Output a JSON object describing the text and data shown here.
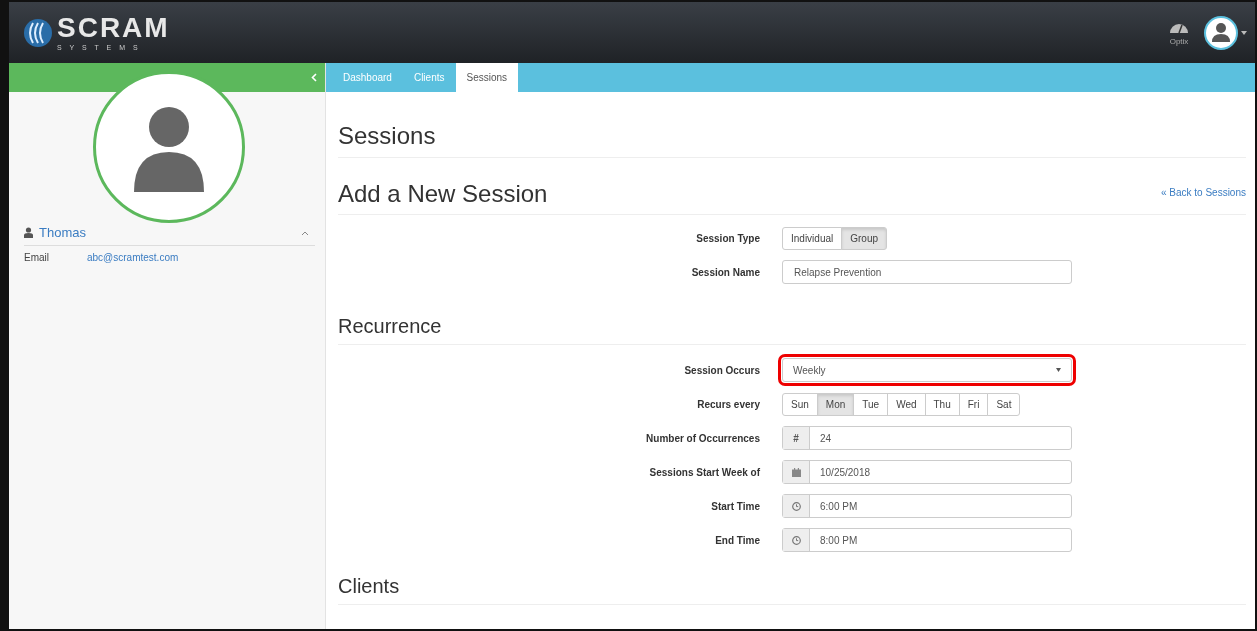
{
  "header": {
    "logo_text": "SCRAM",
    "logo_subtext": "S Y S T E M S",
    "optix_label": "Optix"
  },
  "sidebar": {
    "client_name": "Thomas",
    "expanded": true,
    "details": [
      {
        "label": "Email",
        "value": "abc@scramtest.com"
      }
    ]
  },
  "tabs": [
    {
      "label": "Dashboard",
      "selected": false
    },
    {
      "label": "Clients",
      "selected": false
    },
    {
      "label": "Sessions",
      "selected": true
    }
  ],
  "page_title": "Sessions",
  "form_title": "Add a New Session",
  "back_link": "« Back to Sessions",
  "session_type": {
    "label": "Session Type",
    "options": [
      {
        "label": "Individual",
        "selected": false
      },
      {
        "label": "Group",
        "selected": true
      }
    ]
  },
  "session_name": {
    "label": "Session Name",
    "value": "Relapse Prevention"
  },
  "recurrence_title": "Recurrence",
  "session_occurs": {
    "label": "Session Occurs",
    "value": "Weekly",
    "highlighted": true
  },
  "recurs_every": {
    "label": "Recurs every",
    "days": [
      {
        "label": "Sun",
        "selected": false
      },
      {
        "label": "Mon",
        "selected": true
      },
      {
        "label": "Tue",
        "selected": false
      },
      {
        "label": "Wed",
        "selected": false
      },
      {
        "label": "Thu",
        "selected": false
      },
      {
        "label": "Fri",
        "selected": false
      },
      {
        "label": "Sat",
        "selected": false
      }
    ]
  },
  "fields": [
    {
      "label": "Number of Occurrences",
      "kind": "number",
      "addon": "#",
      "value": "24"
    },
    {
      "label": "Sessions Start Week of",
      "kind": "date",
      "value": "10/25/2018"
    },
    {
      "label": "Start Time",
      "kind": "time",
      "value": "6:00 PM"
    },
    {
      "label": "End Time",
      "kind": "time",
      "value": "8:00 PM"
    }
  ],
  "clients_title": "Clients"
}
